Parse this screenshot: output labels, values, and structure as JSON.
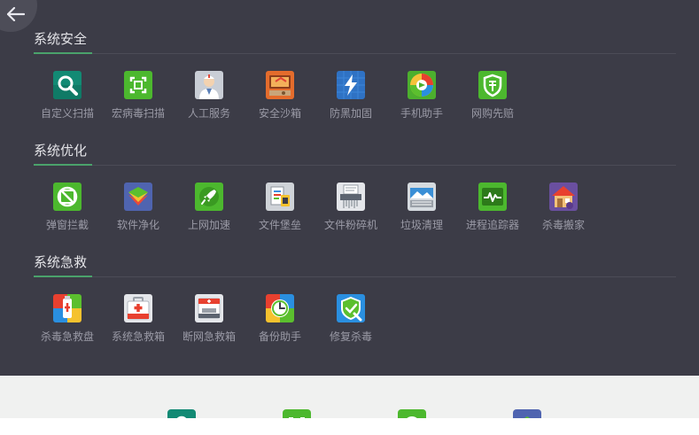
{
  "sections": [
    {
      "title": "系统安全",
      "items": [
        {
          "label": "自定义扫描",
          "icon": "magnifier-icon"
        },
        {
          "label": "宏病毒扫描",
          "icon": "scan-frame-icon"
        },
        {
          "label": "人工服务",
          "icon": "doctor-icon"
        },
        {
          "label": "安全沙箱",
          "icon": "sandbox-icon"
        },
        {
          "label": "防黑加固",
          "icon": "lightning-shield-icon"
        },
        {
          "label": "手机助手",
          "icon": "phone-assistant-icon"
        },
        {
          "label": "网购先赔",
          "icon": "shopping-shield-icon"
        }
      ]
    },
    {
      "title": "系统优化",
      "items": [
        {
          "label": "弹窗拦截",
          "icon": "popup-block-icon"
        },
        {
          "label": "软件净化",
          "icon": "layers-icon"
        },
        {
          "label": "上网加速",
          "icon": "rocket-icon"
        },
        {
          "label": "文件堡垒",
          "icon": "file-vault-icon"
        },
        {
          "label": "文件粉碎机",
          "icon": "shredder-icon"
        },
        {
          "label": "垃圾清理",
          "icon": "cleanup-icon"
        },
        {
          "label": "进程追踪器",
          "icon": "process-monitor-icon"
        },
        {
          "label": "杀毒搬家",
          "icon": "house-move-icon"
        }
      ]
    },
    {
      "title": "系统急救",
      "items": [
        {
          "label": "杀毒急救盘",
          "icon": "usb-rescue-icon"
        },
        {
          "label": "系统急救箱",
          "icon": "first-aid-kit-icon"
        },
        {
          "label": "断网急救箱",
          "icon": "network-aid-kit-icon"
        },
        {
          "label": "备份助手",
          "icon": "backup-clock-icon"
        },
        {
          "label": "修复杀毒",
          "icon": "repair-shield-icon"
        }
      ]
    }
  ],
  "colors": {
    "panel_bg": "#3c3c47",
    "title_text": "#e4e4e8",
    "label_text": "#9a9aa6",
    "accent_green": "#4aa26b"
  }
}
